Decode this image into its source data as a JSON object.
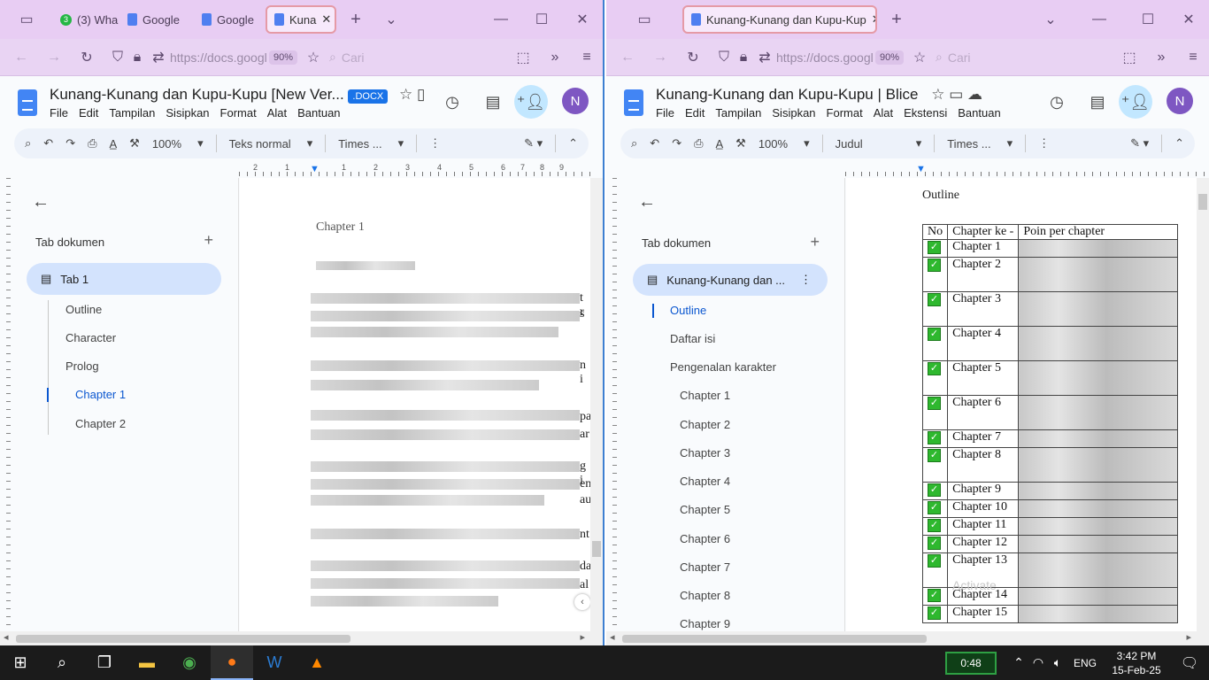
{
  "left": {
    "tabs": [
      {
        "label": "(3) Wha",
        "icon": "whatsapp-icon",
        "badge": "3"
      },
      {
        "label": "Google",
        "icon": "docs-icon"
      },
      {
        "label": "Google",
        "icon": "docs-icon"
      },
      {
        "label": "Kuna",
        "icon": "docs-icon",
        "active": true
      }
    ],
    "url": "https://docs.googl",
    "zoom": "90%",
    "search_placeholder": "Cari",
    "doc_title": "Kunang-Kunang dan Kupu-Kupu [New Ver...",
    "doc_badge": ".DOCX",
    "menu": [
      "File",
      "Edit",
      "Tampilan",
      "Sisipkan",
      "Format",
      "Alat",
      "Bantuan"
    ],
    "avatar": "N",
    "toolbar": {
      "zoom": "100%",
      "style": "Teks normal",
      "font": "Times ..."
    },
    "ruler_labels": [
      "2",
      "1",
      "1",
      "2",
      "3",
      "4",
      "5",
      "6",
      "7",
      "8",
      "9"
    ],
    "sidebar": {
      "title": "Tab dokumen",
      "tab": "Tab 1",
      "outline": [
        "Outline",
        "Character",
        "Prolog",
        "Chapter 1",
        "Chapter 2"
      ],
      "selected": "Chapter 1"
    },
    "page": {
      "heading": "Chapter 1",
      "edge_chars": [
        "t r",
        "s",
        "n i",
        "pa",
        "ar",
        "g i",
        "en",
        "au",
        "nt",
        "da",
        "al"
      ]
    }
  },
  "right": {
    "tab": "Kunang-Kunang dan Kupu-Kup",
    "url": "https://docs.googl",
    "zoom": "90%",
    "search_placeholder": "Cari",
    "doc_title": "Kunang-Kunang dan Kupu-Kupu | Blice",
    "menu": [
      "File",
      "Edit",
      "Tampilan",
      "Sisipkan",
      "Format",
      "Alat",
      "Ekstensi",
      "Bantuan"
    ],
    "avatar": "N",
    "toolbar": {
      "zoom": "100%",
      "style": "Judul",
      "font": "Times ..."
    },
    "sidebar": {
      "title": "Tab dokumen",
      "tab": "Kunang-Kunang dan ...",
      "outline": [
        "Outline",
        "Daftar isi",
        "Pengenalan karakter",
        "Chapter 1",
        "Chapter 2",
        "Chapter 3",
        "Chapter 4",
        "Chapter 5",
        "Chapter 6",
        "Chapter 7",
        "Chapter 8",
        "Chapter 9"
      ],
      "selected": "Outline"
    },
    "page": {
      "heading": "Outline",
      "columns": [
        "No",
        "Chapter ke -",
        "Poin per chapter"
      ],
      "rows": [
        "Chapter 1",
        "Chapter 2",
        "Chapter 3",
        "Chapter 4",
        "Chapter 5",
        "Chapter 6",
        "Chapter 7",
        "Chapter 8",
        "Chapter 9",
        "Chapter 10",
        "Chapter 11",
        "Chapter 12",
        "Chapter 13",
        "Chapter 14",
        "Chapter 15"
      ],
      "watermark": "Activate"
    }
  },
  "taskbar": {
    "battery": "0:48",
    "lang": "ENG",
    "time": "3:42 PM",
    "date": "15-Feb-25"
  }
}
